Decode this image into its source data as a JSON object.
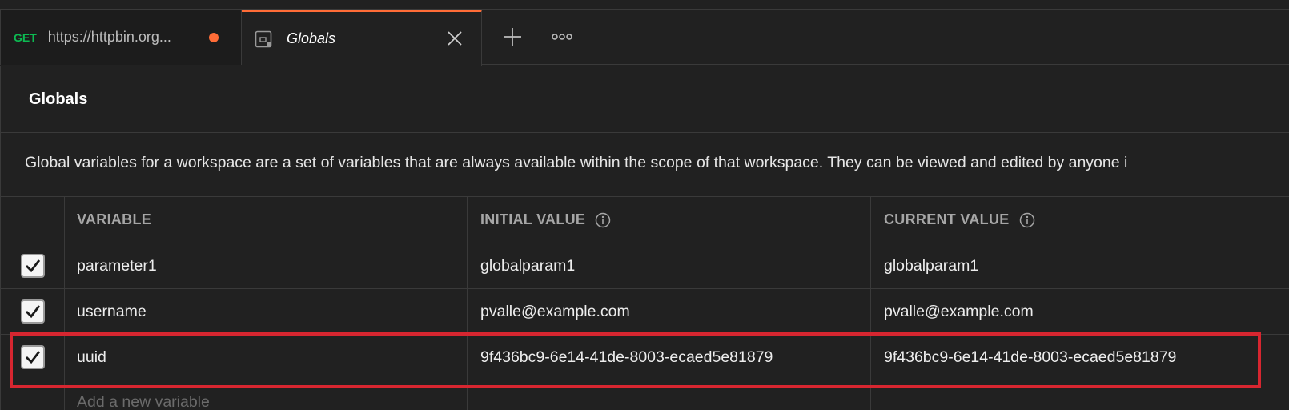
{
  "tabs": [
    {
      "method": "GET",
      "title": "https://httpbin.org...",
      "unsaved": true
    },
    {
      "title": "Globals",
      "icon": "environment-icon"
    }
  ],
  "page": {
    "title": "Globals",
    "description": "Global variables for a workspace are a set of variables that are always available within the scope of that workspace. They can be viewed and edited by anyone i"
  },
  "table": {
    "headers": {
      "variable": "VARIABLE",
      "initial_value": "INITIAL VALUE",
      "current_value": "CURRENT VALUE"
    },
    "rows": [
      {
        "checked": true,
        "variable": "parameter1",
        "initial_value": "globalparam1",
        "current_value": "globalparam1"
      },
      {
        "checked": true,
        "variable": "username",
        "initial_value": "pvalle@example.com",
        "current_value": "pvalle@example.com"
      },
      {
        "checked": true,
        "variable": "uuid",
        "initial_value": "9f436bc9-6e14-41de-8003-ecaed5e81879",
        "current_value": "9f436bc9-6e14-41de-8003-ecaed5e81879"
      }
    ],
    "new_row_placeholder": "Add a new variable"
  },
  "colors": {
    "accent": "#ff6c37",
    "get_method": "#0cbb52",
    "highlight": "#d72630",
    "background": "#212121"
  }
}
